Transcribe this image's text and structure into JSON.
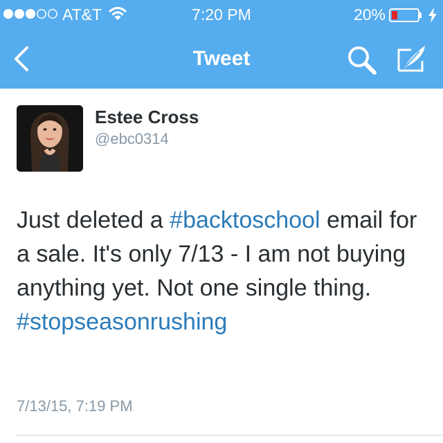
{
  "status_bar": {
    "carrier": "AT&T",
    "time": "7:20 PM",
    "battery_percent": "20%",
    "battery_level": 0.2,
    "signal_bars_filled": 3,
    "signal_bars_total": 5
  },
  "nav": {
    "title": "Tweet",
    "back_icon": "chevron-left-icon",
    "search_icon": "search-icon",
    "compose_icon": "compose-icon"
  },
  "tweet": {
    "author_name": "Estee Cross",
    "author_handle": "@ebc0314",
    "text_part1": "Just deleted a ",
    "hashtag1": "#backtoschool",
    "text_part2": " email for a sale. It's only 7/13 - I am not buying anything yet. Not one single thing.",
    "hashtag2": "#stopseasonrushing",
    "timestamp": "7/13/15, 7:19 PM"
  },
  "colors": {
    "header": "#55acee",
    "hashtag": "#2b7bb9",
    "meta_gray": "#8899a6",
    "battery_low": "#e0262b"
  }
}
